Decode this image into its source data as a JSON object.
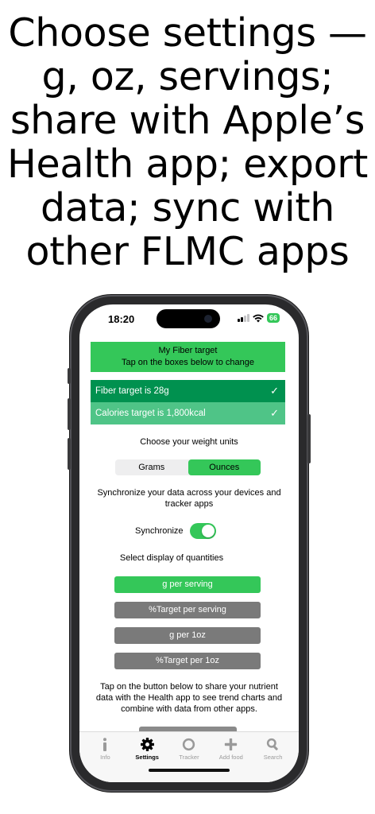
{
  "headline": [
    "Choose settings —",
    "g, oz, servings;",
    "share with Apple’s",
    "Health app; export",
    "data; sync with",
    "other FLMC apps"
  ],
  "status": {
    "time": "18:20",
    "battery": "66"
  },
  "target": {
    "title": "My Fiber target",
    "subtitle": "Tap on the boxes below to change",
    "rows": [
      {
        "label": "Fiber target is 28g",
        "check": "✓"
      },
      {
        "label": "Calories target is 1,800kcal",
        "check": "✓"
      }
    ]
  },
  "units": {
    "label": "Choose your weight units",
    "options": [
      "Grams",
      "Ounces"
    ],
    "selected": "Ounces"
  },
  "sync": {
    "description_line1": "Synchronize your data across your devices and",
    "description_line2": "tracker apps",
    "toggle_label": "Synchronize",
    "enabled": true
  },
  "quantities": {
    "label": "Select display of quantities",
    "options": [
      "g per serving",
      "%Target per serving",
      "g per 1oz",
      "%Target per 1oz"
    ],
    "selected": "g per serving"
  },
  "health": {
    "line1": "Tap on the button below to share your nutrient",
    "line2": "data with the Health app to see trend charts and",
    "line3": "combine with data from other apps."
  },
  "tabs": [
    {
      "label": "Info",
      "icon": "info-icon"
    },
    {
      "label": "Settings",
      "icon": "gear-icon",
      "active": true
    },
    {
      "label": "Tracker",
      "icon": "ring-icon"
    },
    {
      "label": "Add food",
      "icon": "plus-icon"
    },
    {
      "label": "Search",
      "icon": "magnifier-icon"
    }
  ],
  "colors": {
    "accent": "#34c759",
    "dark_green": "#00914f",
    "light_green": "#4fc487",
    "gray_button": "#7a7a7a"
  }
}
